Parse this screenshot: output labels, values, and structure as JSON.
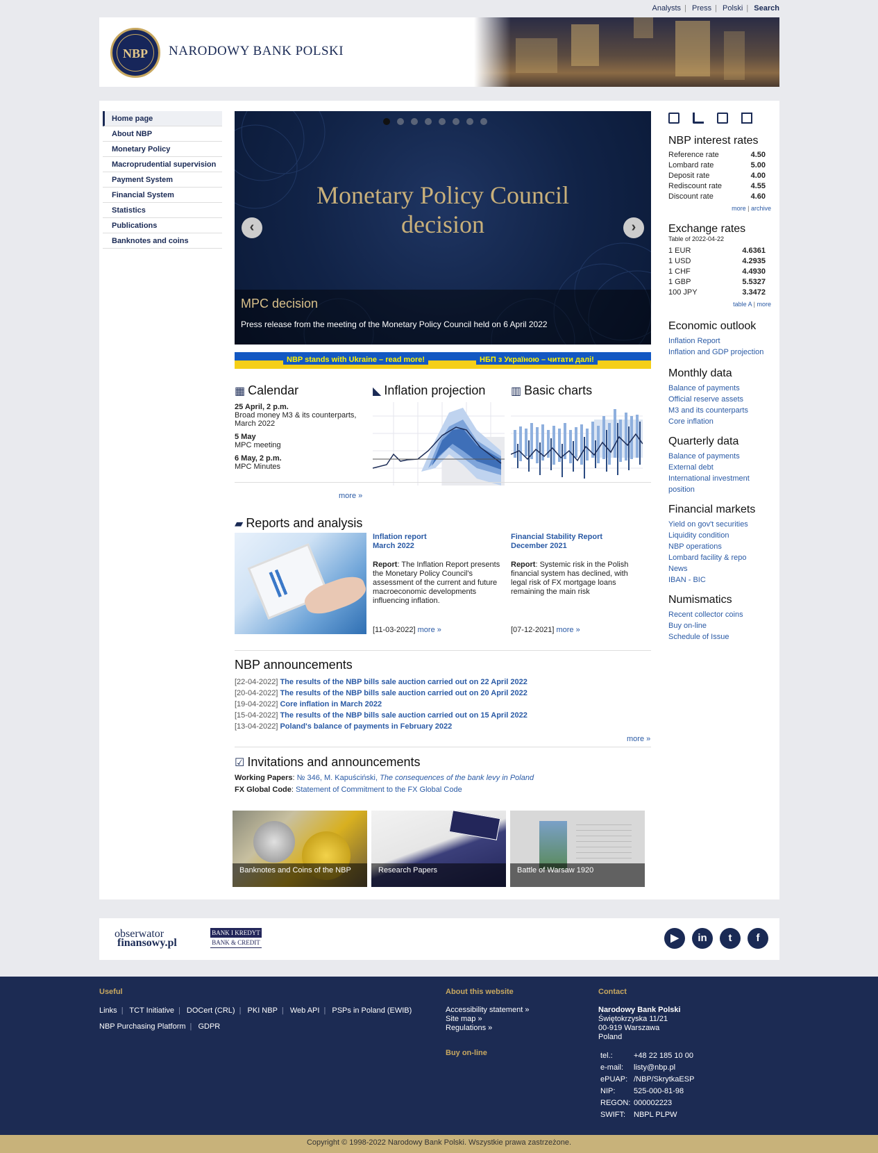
{
  "topnav": {
    "analysts": "Analysts",
    "press": "Press",
    "polski": "Polski",
    "search": "Search"
  },
  "header": {
    "logo_text": "NBP",
    "bank_name": "NARODOWY BANK POLSKI"
  },
  "left_nav": [
    "Home page",
    "About NBP",
    "Monetary Policy",
    "Macroprudential supervision",
    "Payment System",
    "Financial System",
    "Statistics",
    "Publications",
    "Banknotes and coins"
  ],
  "slider": {
    "title": "Monetary Policy Council decision",
    "caption_title": "MPC decision",
    "caption_text": "Press release from the meeting of the Monetary Policy Council held on 6 April 2022",
    "prev": "‹",
    "next": "›"
  },
  "ukraine": {
    "left": "NBP stands with Ukraine – read more!",
    "right": "НБП з Україною – читати далі!"
  },
  "calendar": {
    "title": "Calendar",
    "events": [
      {
        "date": "25 April, 2 p.m.",
        "text": "Broad money M3 & its counterparts, March 2022"
      },
      {
        "date": "5 May",
        "text": "MPC meeting"
      },
      {
        "date": "6 May, 2 p.m.",
        "text": "MPC Minutes"
      }
    ],
    "more": "more »"
  },
  "inflation_projection": {
    "title": "Inflation projection"
  },
  "basic_charts": {
    "title": "Basic charts"
  },
  "reports": {
    "title": "Reports and analysis",
    "items": [
      {
        "title": "Inflation report",
        "subtitle": "March 2022",
        "label": "Report",
        "text": ": The Inflation Report presents the Monetary Policy Council's assessment of the current and future macroeconomic developments influencing inflation.",
        "date": "[11-03-2022]",
        "more": "more »"
      },
      {
        "title": "Financial Stability Report",
        "subtitle": "December 2021",
        "label": "Report",
        "text": ": Systemic risk in the Polish financial system has declined, with legal risk of FX mortgage loans remaining the main risk",
        "date": "[07-12-2021]",
        "more": "more »"
      }
    ]
  },
  "announcements": {
    "title": "NBP announcements",
    "items": [
      {
        "date": "[22-04-2022]",
        "text": "The results of the NBP bills sale auction carried out on 22 April 2022"
      },
      {
        "date": "[20-04-2022]",
        "text": "The results of the NBP bills sale auction carried out on 20 April 2022"
      },
      {
        "date": "[19-04-2022]",
        "text": "Core inflation in March 2022"
      },
      {
        "date": "[15-04-2022]",
        "text": "The results of the NBP bills sale auction carried out on 15 April 2022"
      },
      {
        "date": "[13-04-2022]",
        "text": "Poland's balance of payments in February 2022"
      }
    ],
    "more": "more »"
  },
  "invitations": {
    "title": "Invitations and announcements",
    "wp_label": "Working Papers",
    "wp_link": "№ 346, M. Kapuściński,",
    "wp_title": "The consequences of the bank levy in Poland",
    "fx_label": "FX Global Code",
    "fx_link": "Statement of Commitment to the FX Global Code"
  },
  "tiles": [
    {
      "label": "Banknotes and Coins of the NBP"
    },
    {
      "label": "Research Papers"
    },
    {
      "label": "Battle of Warsaw 1920"
    }
  ],
  "interest_rates": {
    "title": "NBP interest rates",
    "rows": [
      {
        "name": "Reference rate",
        "value": "4.50"
      },
      {
        "name": "Lombard rate",
        "value": "5.00"
      },
      {
        "name": "Deposit rate",
        "value": "4.00"
      },
      {
        "name": "Rediscount rate",
        "value": "4.55"
      },
      {
        "name": "Discount rate",
        "value": "4.60"
      }
    ],
    "more": "more",
    "archive": "archive"
  },
  "exchange_rates": {
    "title": "Exchange rates",
    "table": "Table of 2022-04-22",
    "rows": [
      {
        "name": "1 EUR",
        "value": "4.6361"
      },
      {
        "name": "1 USD",
        "value": "4.2935"
      },
      {
        "name": "1 CHF",
        "value": "4.4930"
      },
      {
        "name": "1 GBP",
        "value": "5.5327"
      },
      {
        "name": "100 JPY",
        "value": "3.3472"
      }
    ],
    "table_a": "table A",
    "more": "more"
  },
  "economic_outlook": {
    "title": "Economic outlook",
    "links": [
      "Inflation Report",
      "Inflation and GDP projection"
    ]
  },
  "monthly_data": {
    "title": "Monthly data",
    "links": [
      "Balance of payments",
      "Official reserve assets",
      "M3 and its counterparts",
      "Core inflation"
    ]
  },
  "quarterly_data": {
    "title": "Quarterly data",
    "links": [
      "Balance of payments",
      "External debt",
      "International investment position"
    ]
  },
  "financial_markets": {
    "title": "Financial markets",
    "links": [
      "Yield on gov't securities",
      "Liquidity condition",
      "NBP operations",
      "Lombard facility & repo",
      "News",
      "IBAN - BIC"
    ]
  },
  "numismatics": {
    "title": "Numismatics",
    "links": [
      "Recent collector coins",
      "Buy on-line",
      "Schedule of Issue"
    ]
  },
  "partners": {
    "obs1": "obserwator",
    "obs2": "finansowy.pl",
    "bk1": "BANK I KREDYT",
    "bk2": "BANK & CREDIT"
  },
  "social": {
    "yt": "▶",
    "li": "in",
    "tw": "t",
    "fb": "f"
  },
  "footer": {
    "useful_title": "Useful",
    "useful_row1": [
      "Links",
      "TCT Initiative",
      "DOCert (CRL)",
      "PKI NBP",
      "Web API",
      "PSPs in Poland (EWIB)"
    ],
    "useful_row2": [
      "NBP Purchasing Platform",
      "GDPR"
    ],
    "about_title": "About this website",
    "about_links": [
      "Accessibility statement »",
      "Site map »",
      "Regulations »"
    ],
    "buy": "Buy on-line",
    "contact_title": "Contact",
    "address": [
      "Narodowy Bank Polski",
      "Świętokrzyska 11/21",
      "00-919 Warszawa",
      "Poland"
    ],
    "contacts": [
      {
        "k": "tel.:",
        "v": "+48 22 185 10 00"
      },
      {
        "k": "e-mail:",
        "v": "listy@nbp.pl"
      },
      {
        "k": "ePUAP:",
        "v": "/NBP/SkrytkaESP"
      },
      {
        "k": "NIP:",
        "v": "525-000-81-98"
      },
      {
        "k": "REGON:",
        "v": "000002223"
      },
      {
        "k": "SWIFT:",
        "v": "NBPL PLPW"
      }
    ]
  },
  "copyright": "Copyright © 1998-2022 Narodowy Bank Polski. Wszystkie prawa zastrzeżone."
}
